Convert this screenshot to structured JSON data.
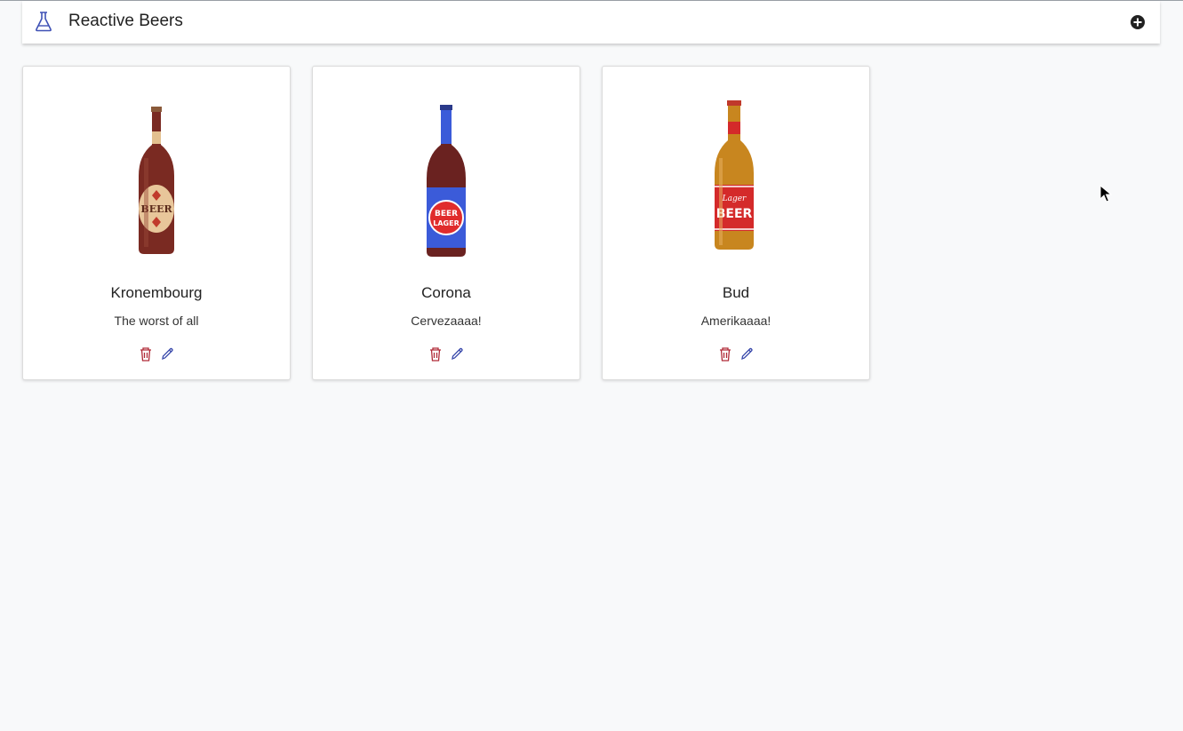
{
  "app": {
    "title": "Reactive Beers"
  },
  "header": {
    "logo_icon": "flask-icon",
    "add_icon": "plus-circle-icon"
  },
  "beers": [
    {
      "name": "Kronembourg",
      "description": "The worst of all",
      "bottle_label": "BEER"
    },
    {
      "name": "Corona",
      "description": "Cervezaaaa!",
      "bottle_label": "BEER LAGER"
    },
    {
      "name": "Bud",
      "description": "Amerikaaaa!",
      "bottle_label": "Lager BEER"
    }
  ],
  "icons": {
    "delete": "trash-icon",
    "edit": "pencil-icon"
  },
  "colors": {
    "delete": "#b02a37",
    "edit": "#3949ab",
    "accent": "#3f51b5"
  }
}
